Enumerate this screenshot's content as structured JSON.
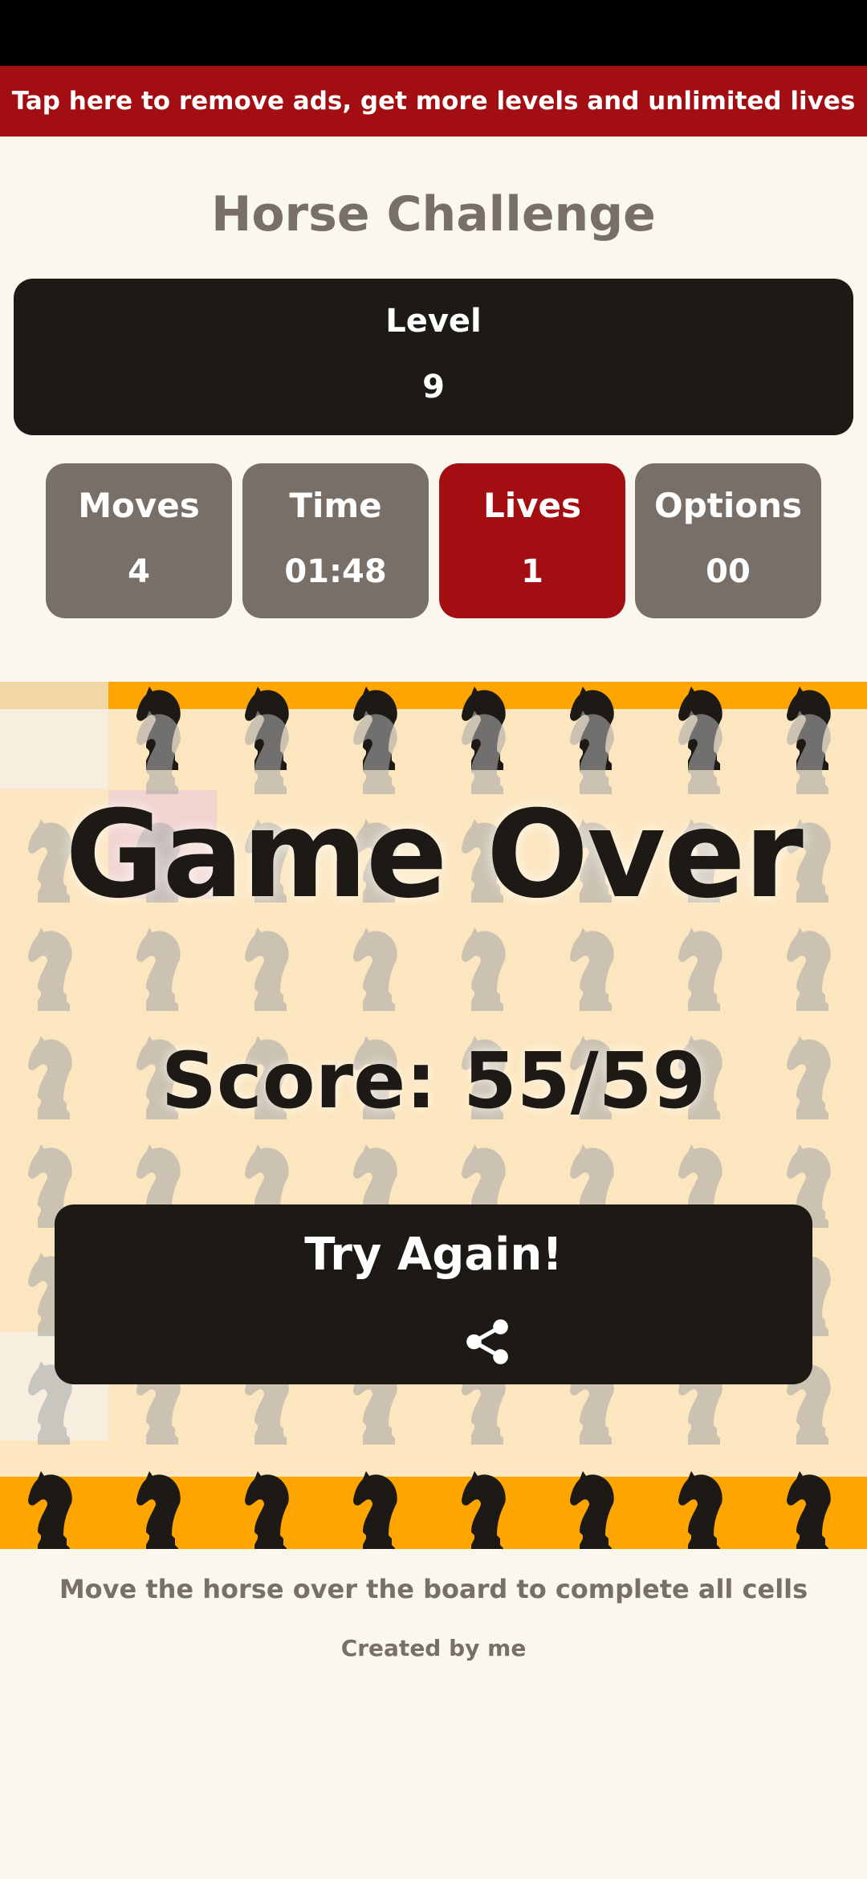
{
  "ad_banner": {
    "text": "Tap here to remove ads, get more levels and unlimited lives"
  },
  "title": "Horse Challenge",
  "level": {
    "label": "Level",
    "value": "9"
  },
  "stats": [
    {
      "label": "Moves",
      "value": "4"
    },
    {
      "label": "Time",
      "value": "01:48"
    },
    {
      "label": "Lives",
      "value": "1"
    },
    {
      "label": "Options",
      "value": "00"
    }
  ],
  "game_over": {
    "title": "Game Over",
    "score": "Score: 55/59",
    "button_label": "Try Again!",
    "share_icon": "share-icon"
  },
  "footer": {
    "instructions": "Move the horse over the board to complete all cells",
    "credit": "Created by me"
  },
  "colors": {
    "background": "#faf7ef",
    "accent_red": "#a30e12",
    "dark": "#1d1a15",
    "stat_gray": "#786f68",
    "board_bg": "#fce6bf",
    "board_band": "#ffa500"
  },
  "board_icon": "knight-icon"
}
